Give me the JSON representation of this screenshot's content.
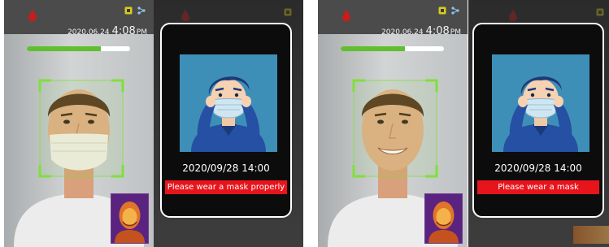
{
  "panels": [
    {
      "camera": {
        "date": "2020.06.24",
        "time": "4:08",
        "ampm": "PM",
        "progress": 0.72,
        "subject": "mask-worn-improperly"
      },
      "result": {
        "datetime": "2020/09/28 14:00",
        "message": "Please wear a mask properly"
      }
    },
    {
      "camera": {
        "date": "2020.06.24",
        "time": "4:08",
        "ampm": "PM",
        "progress": 0.62,
        "subject": "no-mask"
      },
      "result": {
        "datetime": "2020/09/28 14:00",
        "message": "Please wear a mask"
      }
    }
  ],
  "colors": {
    "progress": "#5fbf2e",
    "frame": "#7fe03a",
    "alert": "#e8141c",
    "status_bar": "#4b4b4b"
  },
  "icons": [
    "water-drop-icon",
    "face-mode-icon",
    "network-icon"
  ]
}
